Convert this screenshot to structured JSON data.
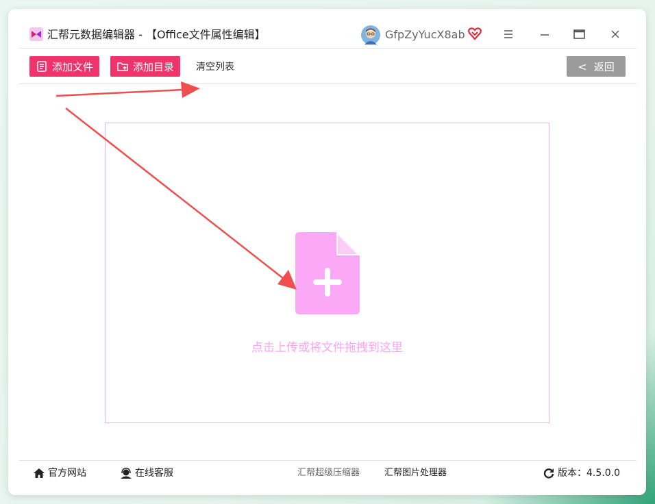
{
  "window": {
    "title": "汇帮元数据编辑器 - 【Office文件属性编辑】",
    "username": "GfpZyYucX8ab",
    "logo_icon": "app-logo-icon",
    "controls": [
      "menu-icon",
      "minimize-icon",
      "maximize-icon",
      "close-icon"
    ]
  },
  "toolbar": {
    "add_file_label": "添加文件",
    "add_dir_label": "添加目录",
    "clear_label": "清空列表",
    "back_label": "返回"
  },
  "dropzone": {
    "hint": "点击上传或将文件拖拽到这里",
    "icon": "file-plus-icon"
  },
  "footer": {
    "website": "官方网站",
    "online_service": "在线客服",
    "compressor": "汇帮超级压缩器",
    "image_tool": "汇帮图片处理器",
    "version_label": "版本：",
    "version": "4.5.0.0"
  },
  "colors": {
    "accent": "#f0336a",
    "drop_border": "#f6a6f2",
    "drop_icon": "#fba9f6",
    "annotation_arrow": "#ee4e4e",
    "back_button": "#9b9b9b"
  }
}
